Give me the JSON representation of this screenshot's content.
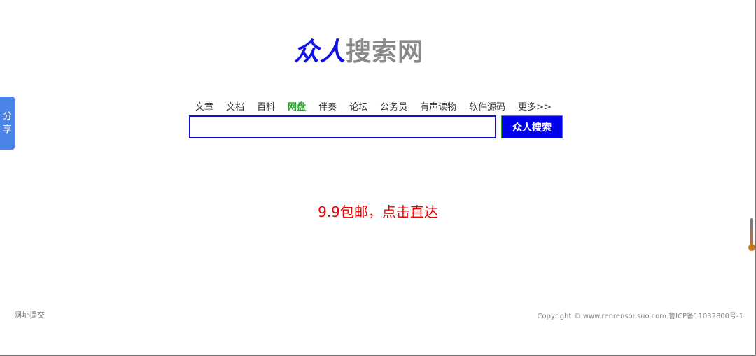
{
  "logo": {
    "part1": "众人",
    "part2": "搜索网"
  },
  "nav": [
    "文章",
    "文档",
    "百科",
    "网盘",
    "伴奏",
    "论坛",
    "公务员",
    "有声读物",
    "软件源码",
    "更多>>"
  ],
  "nav_active": 3,
  "search": {
    "value": "",
    "button": "众人搜索"
  },
  "promo": "9.9包邮，点击直达",
  "share": {
    "line1": "分",
    "line2": "享"
  },
  "footer": {
    "left": "网址提交",
    "right": "Copyright © www.renrensousuo.com 鲁ICP备11032800号-1"
  }
}
